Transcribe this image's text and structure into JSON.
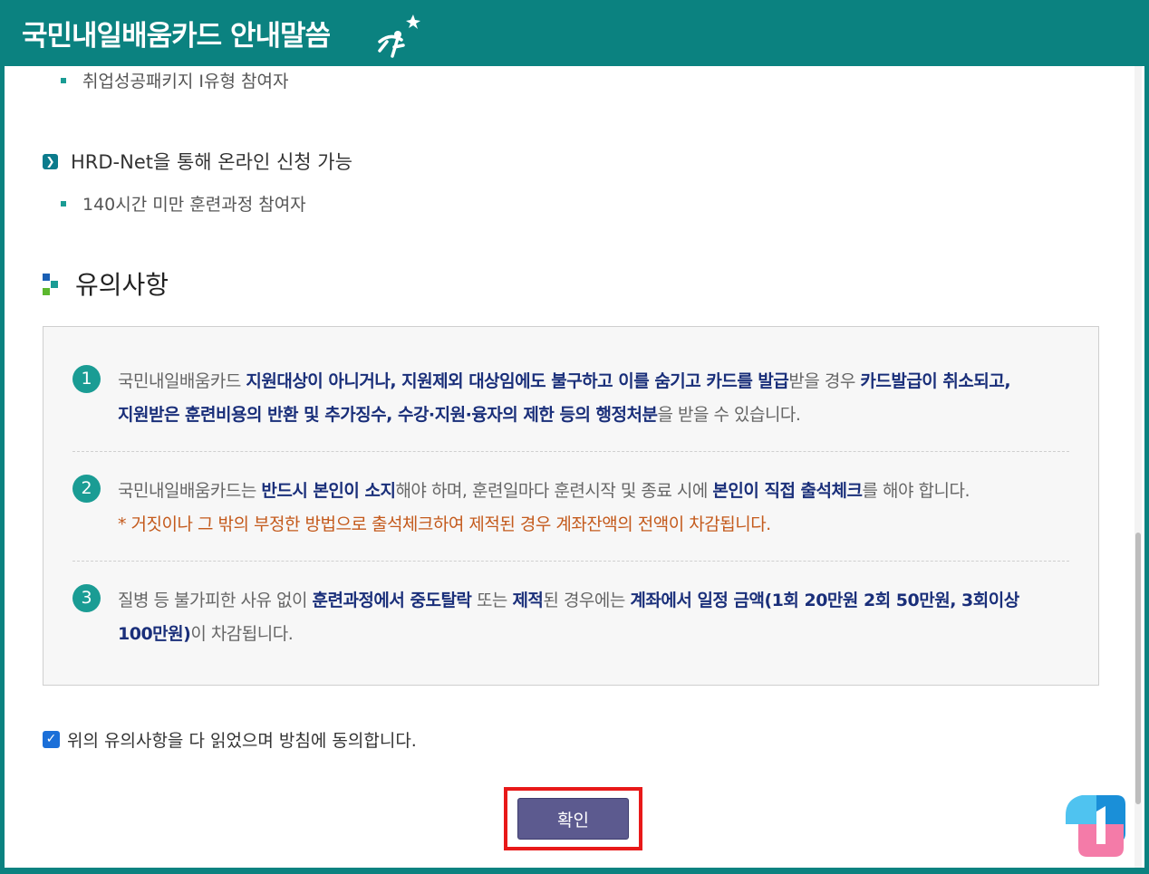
{
  "header": {
    "title": "국민내일배움카드 안내말씀"
  },
  "content": {
    "top_bullet": "취업성공패키지 Ⅰ유형 참여자",
    "online_heading": "HRD-Net을 통해 온라인 신청 가능",
    "online_bullet": "140시간 미만 훈련과정 참여자",
    "section_title": "유의사항",
    "notices": [
      {
        "number": "1",
        "line1": [
          {
            "t": "국민내일배움카드 ",
            "b": false
          },
          {
            "t": "지원대상이 아니거나, 지원제외 대상임에도 불구하고 이를 숨기고 카드를 발급",
            "b": true
          },
          {
            "t": "받을 경우 ",
            "b": false
          },
          {
            "t": "카드발급이 취소되고,",
            "b": true
          }
        ],
        "line2": [
          {
            "t": "지원받은 훈련비용의 반환 및 추가징수, 수강·지원·융자의 제한 등의 행정처분",
            "b": true
          },
          {
            "t": "을 받을 수 있습니다.",
            "b": false
          }
        ]
      },
      {
        "number": "2",
        "line1": [
          {
            "t": "국민내일배움카드는 ",
            "b": false
          },
          {
            "t": "반드시 본인이 소지",
            "b": true
          },
          {
            "t": "해야 하며, 훈련일마다 훈련시작 및 종료 시에 ",
            "b": false
          },
          {
            "t": "본인이 직접 출석체크",
            "b": true
          },
          {
            "t": "를 해야 합니다.",
            "b": false
          }
        ],
        "warning": "* 거짓이나 그 밖의 부정한 방법으로 출석체크하여 제적된 경우 계좌잔액의 전액이 차감됩니다."
      },
      {
        "number": "3",
        "line1": [
          {
            "t": "질병 등 불가피한 사유 없이 ",
            "b": false
          },
          {
            "t": "훈련과정에서 중도탈락",
            "b": true
          },
          {
            "t": " 또는 ",
            "b": false
          },
          {
            "t": "제적",
            "b": true
          },
          {
            "t": "된 경우에는 ",
            "b": false
          },
          {
            "t": "계좌에서 일정 금액(1회 20만원 2회 50만원, 3회이상",
            "b": true
          }
        ],
        "line2": [
          {
            "t": "100만원)",
            "b": true
          },
          {
            "t": "이 차감됩니다.",
            "b": false
          }
        ]
      }
    ],
    "agree_label": "위의 유의사항을 다 읽었으며 방침에 동의합니다.",
    "agree_checked": true,
    "confirm_label": "확인"
  },
  "colors": {
    "header_bg": "#0b8280",
    "accent_teal": "#1a9c94",
    "bold_text": "#1a2f7a",
    "warning_text": "#c45a1c",
    "button_bg": "#5c5a8f",
    "highlight_border": "#e81919"
  }
}
